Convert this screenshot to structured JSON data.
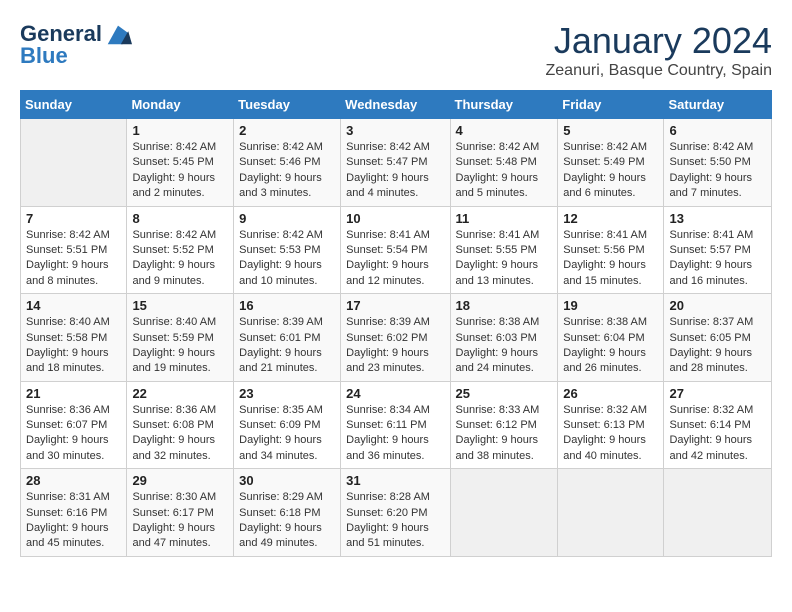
{
  "header": {
    "logo_line1": "General",
    "logo_line2": "Blue",
    "month_title": "January 2024",
    "location": "Zeanuri, Basque Country, Spain"
  },
  "days_of_week": [
    "Sunday",
    "Monday",
    "Tuesday",
    "Wednesday",
    "Thursday",
    "Friday",
    "Saturday"
  ],
  "weeks": [
    [
      {
        "day": "",
        "empty": true
      },
      {
        "day": "1",
        "sunrise": "8:42 AM",
        "sunset": "5:45 PM",
        "daylight": "9 hours and 2 minutes."
      },
      {
        "day": "2",
        "sunrise": "8:42 AM",
        "sunset": "5:46 PM",
        "daylight": "9 hours and 3 minutes."
      },
      {
        "day": "3",
        "sunrise": "8:42 AM",
        "sunset": "5:47 PM",
        "daylight": "9 hours and 4 minutes."
      },
      {
        "day": "4",
        "sunrise": "8:42 AM",
        "sunset": "5:48 PM",
        "daylight": "9 hours and 5 minutes."
      },
      {
        "day": "5",
        "sunrise": "8:42 AM",
        "sunset": "5:49 PM",
        "daylight": "9 hours and 6 minutes."
      },
      {
        "day": "6",
        "sunrise": "8:42 AM",
        "sunset": "5:50 PM",
        "daylight": "9 hours and 7 minutes."
      }
    ],
    [
      {
        "day": "7",
        "sunrise": "8:42 AM",
        "sunset": "5:51 PM",
        "daylight": "9 hours and 8 minutes."
      },
      {
        "day": "8",
        "sunrise": "8:42 AM",
        "sunset": "5:52 PM",
        "daylight": "9 hours and 9 minutes."
      },
      {
        "day": "9",
        "sunrise": "8:42 AM",
        "sunset": "5:53 PM",
        "daylight": "9 hours and 10 minutes."
      },
      {
        "day": "10",
        "sunrise": "8:41 AM",
        "sunset": "5:54 PM",
        "daylight": "9 hours and 12 minutes."
      },
      {
        "day": "11",
        "sunrise": "8:41 AM",
        "sunset": "5:55 PM",
        "daylight": "9 hours and 13 minutes."
      },
      {
        "day": "12",
        "sunrise": "8:41 AM",
        "sunset": "5:56 PM",
        "daylight": "9 hours and 15 minutes."
      },
      {
        "day": "13",
        "sunrise": "8:41 AM",
        "sunset": "5:57 PM",
        "daylight": "9 hours and 16 minutes."
      }
    ],
    [
      {
        "day": "14",
        "sunrise": "8:40 AM",
        "sunset": "5:58 PM",
        "daylight": "9 hours and 18 minutes."
      },
      {
        "day": "15",
        "sunrise": "8:40 AM",
        "sunset": "5:59 PM",
        "daylight": "9 hours and 19 minutes."
      },
      {
        "day": "16",
        "sunrise": "8:39 AM",
        "sunset": "6:01 PM",
        "daylight": "9 hours and 21 minutes."
      },
      {
        "day": "17",
        "sunrise": "8:39 AM",
        "sunset": "6:02 PM",
        "daylight": "9 hours and 23 minutes."
      },
      {
        "day": "18",
        "sunrise": "8:38 AM",
        "sunset": "6:03 PM",
        "daylight": "9 hours and 24 minutes."
      },
      {
        "day": "19",
        "sunrise": "8:38 AM",
        "sunset": "6:04 PM",
        "daylight": "9 hours and 26 minutes."
      },
      {
        "day": "20",
        "sunrise": "8:37 AM",
        "sunset": "6:05 PM",
        "daylight": "9 hours and 28 minutes."
      }
    ],
    [
      {
        "day": "21",
        "sunrise": "8:36 AM",
        "sunset": "6:07 PM",
        "daylight": "9 hours and 30 minutes."
      },
      {
        "day": "22",
        "sunrise": "8:36 AM",
        "sunset": "6:08 PM",
        "daylight": "9 hours and 32 minutes."
      },
      {
        "day": "23",
        "sunrise": "8:35 AM",
        "sunset": "6:09 PM",
        "daylight": "9 hours and 34 minutes."
      },
      {
        "day": "24",
        "sunrise": "8:34 AM",
        "sunset": "6:11 PM",
        "daylight": "9 hours and 36 minutes."
      },
      {
        "day": "25",
        "sunrise": "8:33 AM",
        "sunset": "6:12 PM",
        "daylight": "9 hours and 38 minutes."
      },
      {
        "day": "26",
        "sunrise": "8:32 AM",
        "sunset": "6:13 PM",
        "daylight": "9 hours and 40 minutes."
      },
      {
        "day": "27",
        "sunrise": "8:32 AM",
        "sunset": "6:14 PM",
        "daylight": "9 hours and 42 minutes."
      }
    ],
    [
      {
        "day": "28",
        "sunrise": "8:31 AM",
        "sunset": "6:16 PM",
        "daylight": "9 hours and 45 minutes."
      },
      {
        "day": "29",
        "sunrise": "8:30 AM",
        "sunset": "6:17 PM",
        "daylight": "9 hours and 47 minutes."
      },
      {
        "day": "30",
        "sunrise": "8:29 AM",
        "sunset": "6:18 PM",
        "daylight": "9 hours and 49 minutes."
      },
      {
        "day": "31",
        "sunrise": "8:28 AM",
        "sunset": "6:20 PM",
        "daylight": "9 hours and 51 minutes."
      },
      {
        "day": "",
        "empty": true
      },
      {
        "day": "",
        "empty": true
      },
      {
        "day": "",
        "empty": true
      }
    ]
  ],
  "labels": {
    "sunrise_prefix": "Sunrise:",
    "sunset_prefix": "Sunset:",
    "daylight_prefix": "Daylight:"
  }
}
